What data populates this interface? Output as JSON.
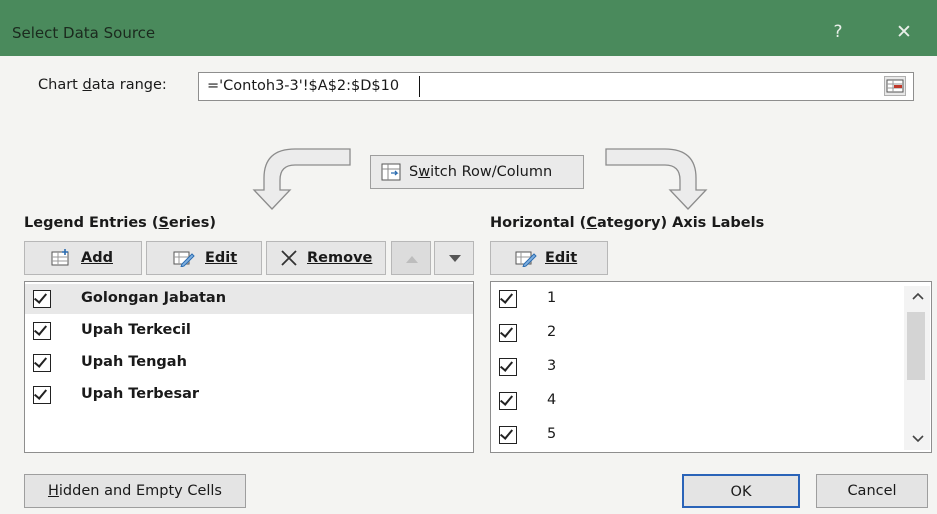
{
  "dialog": {
    "title": "Select Data Source",
    "help_glyph": "?",
    "close_glyph": "✕"
  },
  "data_range": {
    "label_pre": "Chart ",
    "label_key": "d",
    "label_post": "ata range:",
    "value": "='Contoh3-3'!$A$2:$D$10"
  },
  "switch": {
    "pre": "S",
    "key": "w",
    "post": "itch Row/Column"
  },
  "legend": {
    "heading_pre": "Legend Entries (",
    "heading_key": "S",
    "heading_post": "eries)",
    "add_label": "Add",
    "edit_label": "Edit",
    "remove_label": "Remove",
    "items": [
      {
        "label": "Golongan Jabatan",
        "checked": true
      },
      {
        "label": "Upah Terkecil",
        "checked": true
      },
      {
        "label": "Upah Tengah",
        "checked": true
      },
      {
        "label": "Upah Terbesar",
        "checked": true
      }
    ]
  },
  "axis": {
    "heading_pre": "Horizontal (",
    "heading_key": "C",
    "heading_post": "ategory) Axis Labels",
    "edit_label": "Edit",
    "items": [
      {
        "label": "1",
        "checked": true
      },
      {
        "label": "2",
        "checked": true
      },
      {
        "label": "3",
        "checked": true
      },
      {
        "label": "4",
        "checked": true
      },
      {
        "label": "5",
        "checked": true
      }
    ]
  },
  "footer": {
    "hidden_pre": "",
    "hidden_key": "H",
    "hidden_post": "idden and Empty Cells",
    "ok_label": "OK",
    "cancel_label": "Cancel"
  },
  "colors": {
    "titlebar": "#4a8a5c",
    "ok_border": "#2a63b8"
  }
}
